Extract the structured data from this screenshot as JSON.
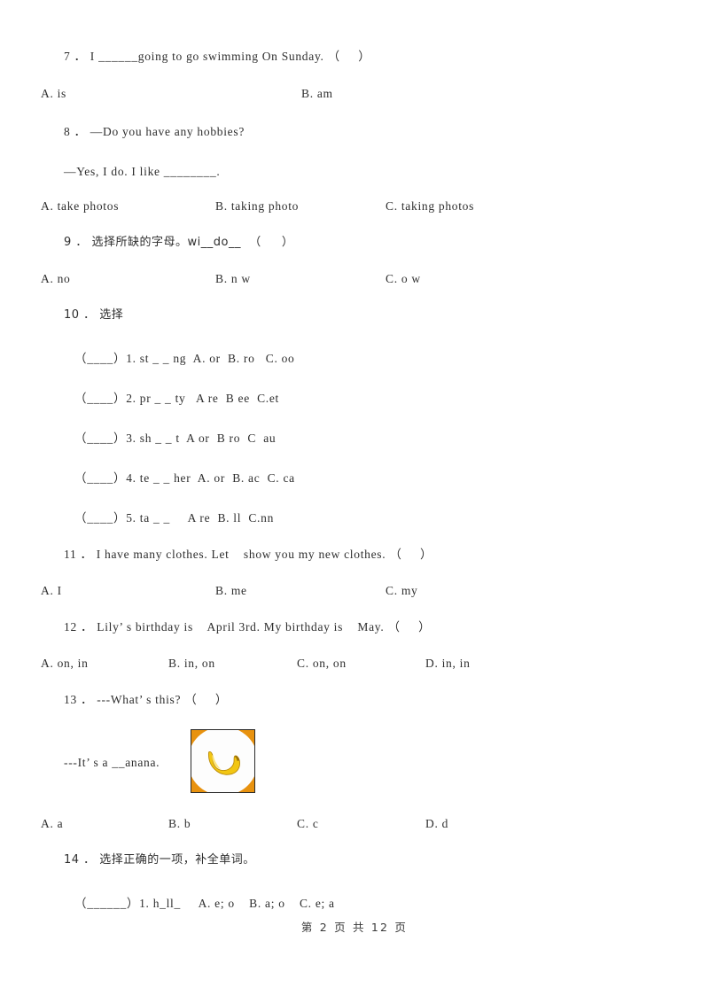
{
  "document": {
    "page_footer": "第 2 页 共 12 页",
    "page_number": "2",
    "total_pages": "12",
    "background_color": "#ffffff",
    "text_color": "#2e2e2e"
  },
  "questions": [
    {
      "number": "7",
      "stem": "7 ． I ______going to go swimming On Sunday. （     ）",
      "options": [
        {
          "label": "A. is"
        },
        {
          "label": "B. am"
        }
      ]
    },
    {
      "number": "8",
      "stem": "8 ． —Do you have any hobbies?",
      "stem2": "—Yes, I do. I like ________.",
      "options": [
        {
          "label": "A. take photos"
        },
        {
          "label": "B. taking photo"
        },
        {
          "label": "C. taking photos"
        }
      ]
    },
    {
      "number": "9",
      "stem": "9 ． 选择所缺的字母。wi__do__  （     ）",
      "options": [
        {
          "label": "A. no"
        },
        {
          "label": "B. n w"
        },
        {
          "label": "C. o w"
        }
      ]
    },
    {
      "number": "10",
      "stem": "10 ． 选择",
      "sub_items": [
        "（____）1. st _ _ ng  A. or  B. ro   C. oo",
        "（____）2. pr _ _ ty   A re  B ee  C.et",
        "（____）3. sh _ _ t  A or  B ro  C  au",
        "（____）4. te _ _ her  A. or  B. ac  C. ca",
        "（____）5. ta _ _     A re  B. ll  C.nn"
      ]
    },
    {
      "number": "11",
      "stem": "11 ． I have many clothes. Let    show you my new clothes. （     ）",
      "options": [
        {
          "label": "A. I"
        },
        {
          "label": "B. me"
        },
        {
          "label": "C. my"
        }
      ]
    },
    {
      "number": "12",
      "stem": "12 ． Lily’ s birthday is    April 3rd. My birthday is    May. （     ）",
      "options": [
        {
          "label": "A. on, in"
        },
        {
          "label": "B. in, on"
        },
        {
          "label": "C. on, on"
        },
        {
          "label": "D. in, in"
        }
      ]
    },
    {
      "number": "13",
      "stem": "13 ． ---What’ s this? （     ）",
      "answer_line": "---It’ s a __anana.",
      "image": {
        "alt": "banana-picture",
        "background_color": "#e8920f",
        "disc_color": "#fdfdfd",
        "banana_color": "#f0c419",
        "border_color": "#2a2a2a"
      },
      "options": [
        {
          "label": "A. a"
        },
        {
          "label": "B. b"
        },
        {
          "label": "C. c"
        },
        {
          "label": "D. d"
        }
      ]
    },
    {
      "number": "14",
      "stem": "14 ． 选择正确的一项，补全单词。",
      "sub_items": [
        "（______）1. h_ll_     A. e; o    B. a; o    C. e; a"
      ]
    }
  ]
}
